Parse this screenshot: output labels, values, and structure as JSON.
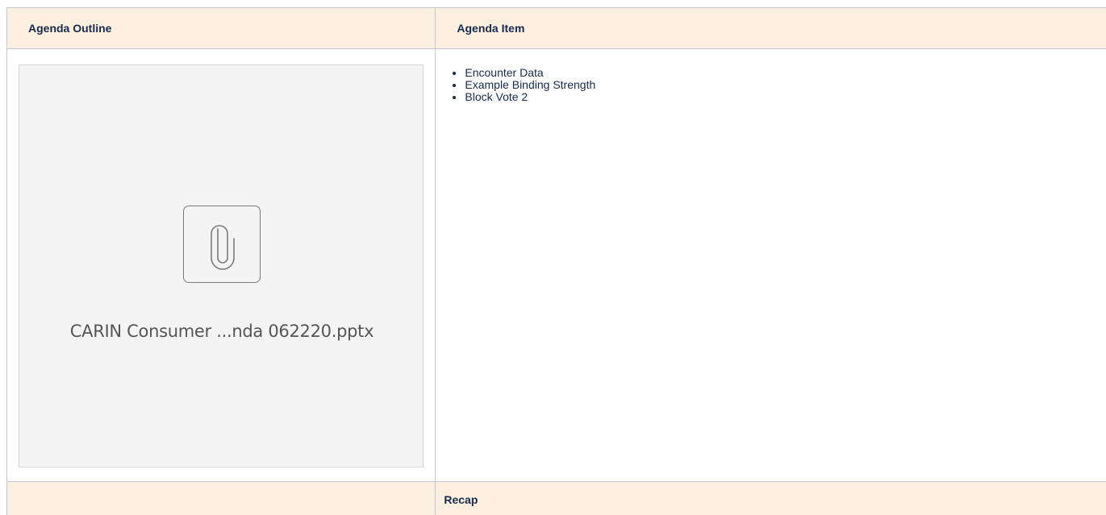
{
  "table": {
    "header": {
      "col1": "Agenda Outline",
      "col2": "Agenda Item"
    },
    "attachment": {
      "filename": "CARIN Consumer ...nda 062220.pptx",
      "icon": "paperclip-icon"
    },
    "agenda_items": [
      "Encounter Data",
      "Example Binding Strength",
      "Block Vote 2"
    ],
    "recap": {
      "label": "Recap"
    }
  },
  "colors": {
    "header_bg": "#fbefe0",
    "border": "#c1c7d0",
    "attachment_bg": "#f4f4f4"
  }
}
